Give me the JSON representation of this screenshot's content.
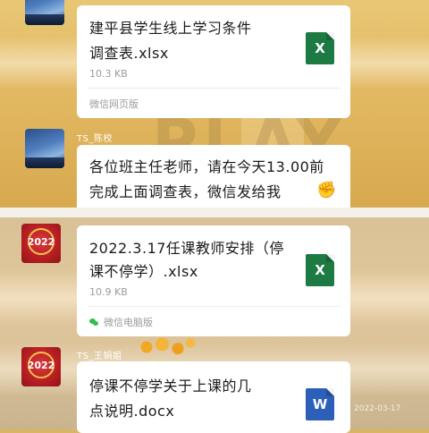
{
  "chat": {
    "top_message": {
      "file_title": "建平县学生线上学习条件调查表.xlsx",
      "file_title_line1": "建平县学生线上学习条件",
      "file_title_line2": "调查表.xlsx",
      "file_size": "10.3 KB",
      "file_icon": "excel-file-icon",
      "file_icon_letter": "X",
      "source": "微信网页版"
    },
    "text_message": {
      "sender": "TS_陈校",
      "line1": "各位班主任老师，请在今天13.00前",
      "line2": "完成上面调查表，微信发给我",
      "emoji": "✊"
    },
    "second_message": {
      "sender": "TS_王娟姐",
      "file_title_line1": "2022.3.17任课教师安排（停",
      "file_title_line2": "课不停学）.xlsx",
      "file_size": "10.9 KB",
      "file_icon": "excel-file-icon",
      "file_icon_letter": "X",
      "source": "微信电脑版",
      "avatar_text": "2022"
    },
    "third_message": {
      "sender": "TS_王娟姐",
      "file_title_line1": "停课不停学关于上课的几",
      "file_title_line2": "点说明.docx",
      "file_icon": "word-file-icon",
      "file_icon_letter": "W",
      "avatar_text": "2022"
    },
    "watermark": "2022-03-17"
  },
  "colors": {
    "excel_green": "#1d7a43",
    "word_blue": "#2b5fb8",
    "wechat_green": "#2fbf4f",
    "bubble_bg": "#ffffff"
  }
}
